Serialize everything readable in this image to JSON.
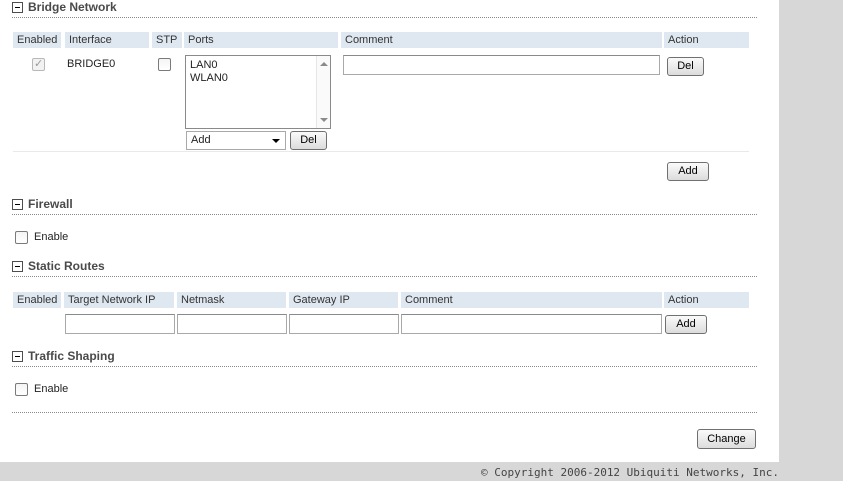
{
  "bridge": {
    "title": "Bridge Network",
    "headers": {
      "enabled": "Enabled",
      "interface": "Interface",
      "stp": "STP",
      "ports": "Ports",
      "comment": "Comment",
      "action": "Action"
    },
    "row": {
      "enabled": true,
      "interface": "BRIDGE0",
      "stp": false,
      "ports": [
        "LAN0",
        "WLAN0"
      ],
      "comment": "",
      "del_label": "Del",
      "port_select": "Add",
      "port_del_label": "Del"
    },
    "add_label": "Add"
  },
  "firewall": {
    "title": "Firewall",
    "enable_label": "Enable",
    "enabled": false
  },
  "static_routes": {
    "title": "Static Routes",
    "headers": {
      "enabled": "Enabled",
      "target": "Target Network IP",
      "netmask": "Netmask",
      "gateway": "Gateway IP",
      "comment": "Comment",
      "action": "Action"
    },
    "new_row": {
      "target": "",
      "netmask": "",
      "gateway": "",
      "comment": "",
      "add_label": "Add"
    }
  },
  "traffic_shaping": {
    "title": "Traffic Shaping",
    "enable_label": "Enable",
    "enabled": false
  },
  "change_label": "Change",
  "footer": {
    "copyright": "© Copyright 2006-2012 Ubiquiti Networks, Inc."
  }
}
